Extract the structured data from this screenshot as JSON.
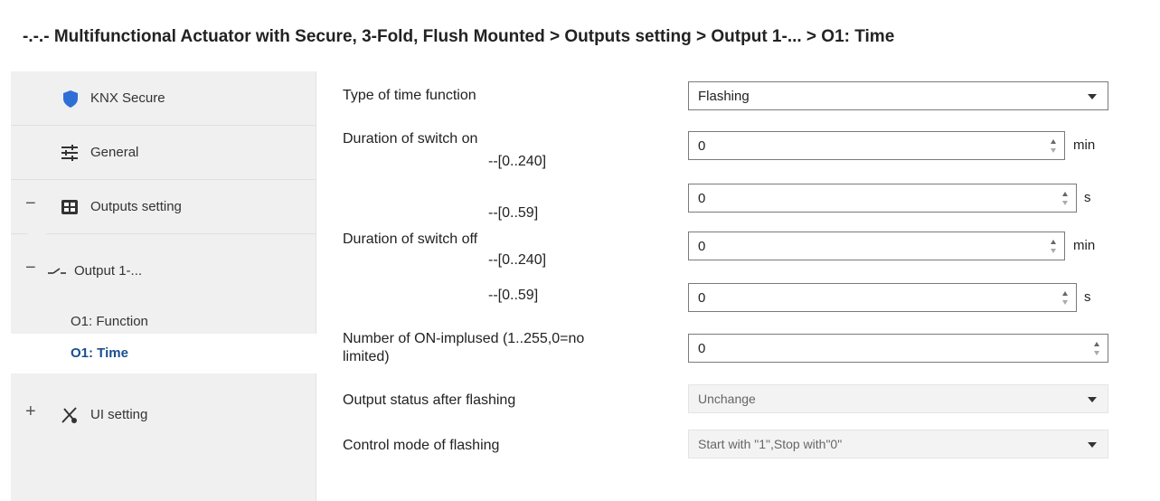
{
  "header": {
    "breadcrumb": "-.-.- Multifunctional Actuator with Secure, 3-Fold, Flush Mounted > Outputs setting > Output 1-... > O1: Time"
  },
  "sidebar": {
    "items": [
      {
        "label": "KNX Secure",
        "icon": "shield-icon"
      },
      {
        "label": "General",
        "icon": "sliders-icon"
      },
      {
        "label": "Outputs setting",
        "icon": "module-icon",
        "expander": "−"
      },
      {
        "label": "Output 1-...",
        "icon": "switch-icon",
        "expander": "−"
      },
      {
        "label": "O1: Function"
      },
      {
        "label": "O1: Time",
        "selected": true
      },
      {
        "label": "UI setting",
        "icon": "ui-tools-icon",
        "expander": "+"
      }
    ]
  },
  "params": {
    "type_of_time_function": {
      "label": "Type of time function",
      "value": "Flashing"
    },
    "duration_on": {
      "label": "Duration of switch on",
      "min_range": "--[0..240]",
      "min_value": "0",
      "min_unit": "min",
      "sec_range": "--[0..59]",
      "sec_value": "0",
      "sec_unit": "s"
    },
    "duration_off": {
      "label": "Duration of switch off",
      "min_range": "--[0..240]",
      "min_value": "0",
      "min_unit": "min",
      "sec_range": "--[0..59]",
      "sec_value": "0",
      "sec_unit": "s"
    },
    "on_impulses": {
      "label_line1": "Number of ON-implused (1..255,0=no",
      "label_line2": "limited)",
      "value": "0"
    },
    "status_after_flashing": {
      "label": "Output status after flashing",
      "value": "Unchange"
    },
    "control_mode": {
      "label": "Control mode of flashing",
      "value": "Start with \"1\",Stop with\"0\""
    }
  },
  "colors": {
    "accent": "#1a4f8f",
    "shield": "#2e6fd6",
    "sidebar_bg": "#f0f0f0"
  }
}
